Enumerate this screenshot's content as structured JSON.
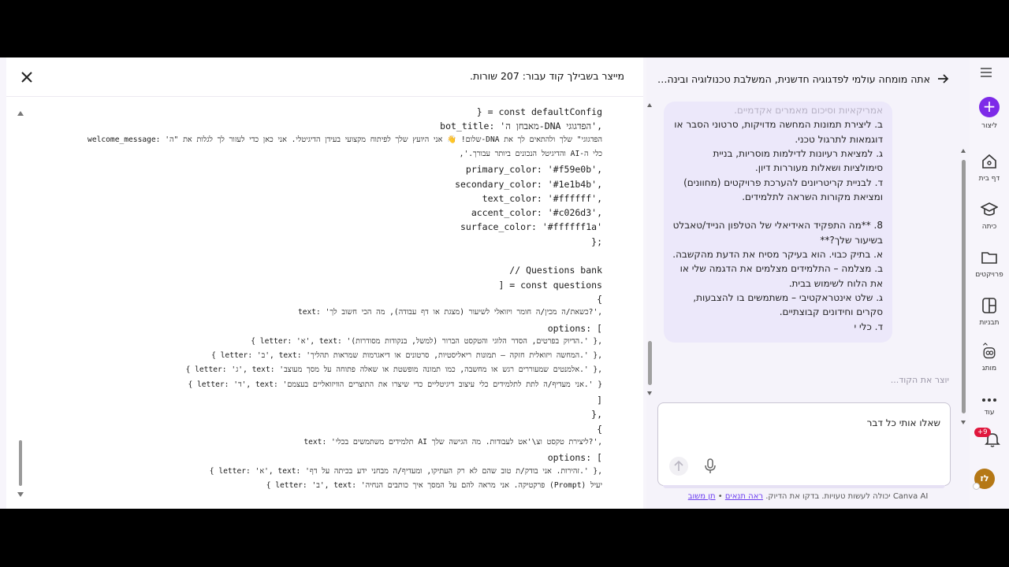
{
  "code_panel": {
    "title": "מייצר בשבילך קוד עבור: 207 שורות.",
    "lines": [
      {
        "text": "} = const defaultConfig",
        "cls": ""
      },
      {
        "text": "bot_title: 'מאבחן ה-DNA הפדגוגי',",
        "cls": ""
      },
      {
        "text": "welcome_message: 'שלום! 👋 אני היועץ שלך לפיתוח מקצועי בעידן הדיגיטלי. אני כאן כדי לעזור לך לגלות את \"ה-DNA הפדגוגי\" שלך ולהתאים לך את",
        "cls": "small"
      },
      {
        "text": "כלי ה-AI והדיגיטל הנכונים ביותר עבורך.',",
        "cls": "small"
      },
      {
        "text": "primary_color: '#f59e0b',",
        "cls": ""
      },
      {
        "text": "secondary_color: '#1e1b4b',",
        "cls": ""
      },
      {
        "text": "text_color: '#ffffff',",
        "cls": ""
      },
      {
        "text": "accent_color: '#c026d3',",
        "cls": ""
      },
      {
        "text": "surface_color: '#ffffff1a'",
        "cls": ""
      },
      {
        "text": "};",
        "cls": ""
      },
      {
        "text": "",
        "cls": ""
      },
      {
        "text": "// Questions bank",
        "cls": ""
      },
      {
        "text": "] = const questions",
        "cls": ""
      },
      {
        "text": "{",
        "cls": ""
      },
      {
        "text": "text: 'כשאת/ה מכין/ה חומר ויזואלי לשיעור (מצגת או דף עבודה), מה הכי חשוב לך?',",
        "cls": "small"
      },
      {
        "text": "options: [",
        "cls": ""
      },
      {
        "text": "{ letter: 'א', text: 'הדיוק בפרטים, הסדר הלוגי והטקסט הברור (למשל, בנקודות מסודרות).' },",
        "cls": "small"
      },
      {
        "text": "{ letter: 'ב', text: 'המחשה ויזואלית חזקה – תמונות ריאליסטיות, סרטונים או דיאגרמות שמראות תהליך.' },",
        "cls": "small"
      },
      {
        "text": "{ letter: 'ג', text: 'אלמנטים שמעוררים רגש או מחשבה, כמו תמונה מופשטת או שאלה פתוחה על מסך מעוצב.' },",
        "cls": "small"
      },
      {
        "text": "{ letter: 'ד', text: 'אני מעדיף/ה לתת לתלמידים כלי עיצוב דיגיטליים כדי שיצרו את התוצרים הוויזואליים בעצמם.' }",
        "cls": "small"
      },
      {
        "text": "]",
        "cls": ""
      },
      {
        "text": "},",
        "cls": ""
      },
      {
        "text": "{",
        "cls": ""
      },
      {
        "text": "text: 'תלמידים משתמשים בכלי AI ליצירת טקסט וצ\\'אט לעבודות. מה הגישה שלך?',",
        "cls": "small"
      },
      {
        "text": "options: [",
        "cls": ""
      },
      {
        "text": "{ letter: 'א', text: 'זהירות. אני בודק/ת טוב שהם לא רק העתיקו, ומעדיף/ה מבחני ידע בכיתה על דף.' },",
        "cls": "small"
      },
      {
        "text": "{ letter: 'ב', text: 'פרקטיקה. אני מראה להם על המסך איך כותבים הנחיה (Prompt) יעיל",
        "cls": "small"
      }
    ]
  },
  "chat": {
    "title": "אתה מומחה עולמי לפדגוגיה חדשנית, המשלבת טכנולוגיה ובינה מלאכ...",
    "bubble_lines": [
      {
        "text": "אמריקאיות וסיכום מאמרים אקדמיים.",
        "fade": true
      },
      {
        "text": "ב. ליצירת תמונות המחשה מדויקות, סרטוני הסבר או",
        "fade": false
      },
      {
        "text": "דוגמאות לתרגול טכני.",
        "fade": false
      },
      {
        "text": "ג. למציאת רעיונות לדילמות מוסריות, בניית",
        "fade": false
      },
      {
        "text": "סימולציות ושאלות מעוררות דיון.",
        "fade": false
      },
      {
        "text": "ד. לבניית קריטריונים להערכת פרויקטים (מחוונים)",
        "fade": false
      },
      {
        "text": "ומציאת מקורות השראה לתלמידים.",
        "fade": false
      },
      {
        "text": "",
        "fade": false
      },
      {
        "text": "8. **מה התפקיד האידיאלי של הטלפון הנייד/טאבלט",
        "fade": false
      },
      {
        "text": "בשיעור שלך?**",
        "fade": false
      },
      {
        "text": "א. בתיק כבוי. הוא בעיקר מסיח את הדעת מהקשבה.",
        "fade": false
      },
      {
        "text": "ב. מצלמה – התלמידים מצלמים את הדגמה שלי או",
        "fade": false
      },
      {
        "text": "את הלוח לשימוש בבית.",
        "fade": false
      },
      {
        "text": "ג. שלט אינטראקטיבי – משתמשים בו להצבעות,",
        "fade": false
      },
      {
        "text": "סקרים וחידונים קבוצתיים.",
        "fade": false
      },
      {
        "text": "ד. כלי י",
        "fade": false
      }
    ],
    "status": "יוצר את הקוד...",
    "input_value": "שאלו אותי כל דבר",
    "input_placeholder": "שאלו אותי כל דבר",
    "footer_text": "Canva AI יכולה לעשות טעויות. בדקו את הדיוק.",
    "footer_link_1": "ראה תנאים",
    "footer_sep": "•",
    "footer_link_2": "תן משוב"
  },
  "rail": {
    "create": "ליצור",
    "home": "דף בית",
    "class": "כיתה",
    "projects": "פרויקטים",
    "templates": "תבניות",
    "brand": "מותג",
    "more": "עוד",
    "notif_count": "+9",
    "avatar_text": "לז",
    "accent": "#7d2ae8"
  }
}
